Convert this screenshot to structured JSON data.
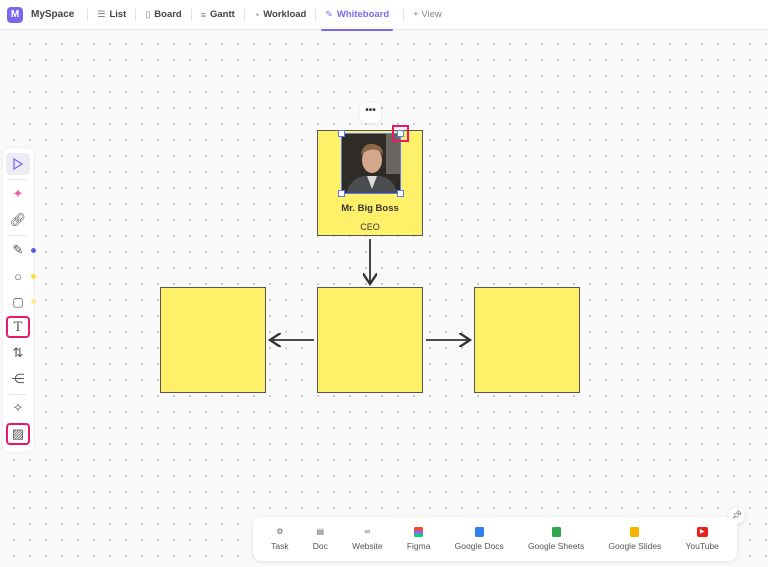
{
  "header": {
    "logo_letter": "M",
    "space": "MySpace",
    "tabs": [
      {
        "label": "List",
        "icon": "list-icon"
      },
      {
        "label": "Board",
        "icon": "board-icon"
      },
      {
        "label": "Gantt",
        "icon": "gantt-icon"
      },
      {
        "label": "Workload",
        "icon": "gauge-icon"
      },
      {
        "label": "Whiteboard",
        "icon": "whiteboard-icon",
        "active": true
      }
    ],
    "add_view": "+ View"
  },
  "toolbar": {
    "tools": [
      "select",
      "ai",
      "link",
      "pen",
      "shape",
      "sticky-note",
      "text",
      "connector",
      "mind-map",
      "magic",
      "image"
    ],
    "highlighted": [
      "text",
      "image"
    ],
    "color_dots": {
      "pen": "#5b5bf0",
      "shape": "#f7e04a",
      "sticky": "#fbe89a"
    }
  },
  "board": {
    "more_label": "•••",
    "card": {
      "name": "Mr. Big Boss",
      "role": "CEO"
    },
    "box_color": "#fff06a"
  },
  "bottombar": {
    "items": [
      {
        "label": "Task",
        "icon": "task-icon"
      },
      {
        "label": "Doc",
        "icon": "doc-icon"
      },
      {
        "label": "Website",
        "icon": "link-icon"
      },
      {
        "label": "Figma",
        "icon": "figma-icon"
      },
      {
        "label": "Google Docs",
        "icon": "google-docs-icon",
        "color": "#2f80ed"
      },
      {
        "label": "Google Sheets",
        "icon": "google-sheets-icon",
        "color": "#2fa84f"
      },
      {
        "label": "Google Slides",
        "icon": "google-slides-icon",
        "color": "#f6b400"
      },
      {
        "label": "YouTube",
        "icon": "youtube-icon",
        "color": "#e62117"
      }
    ]
  }
}
